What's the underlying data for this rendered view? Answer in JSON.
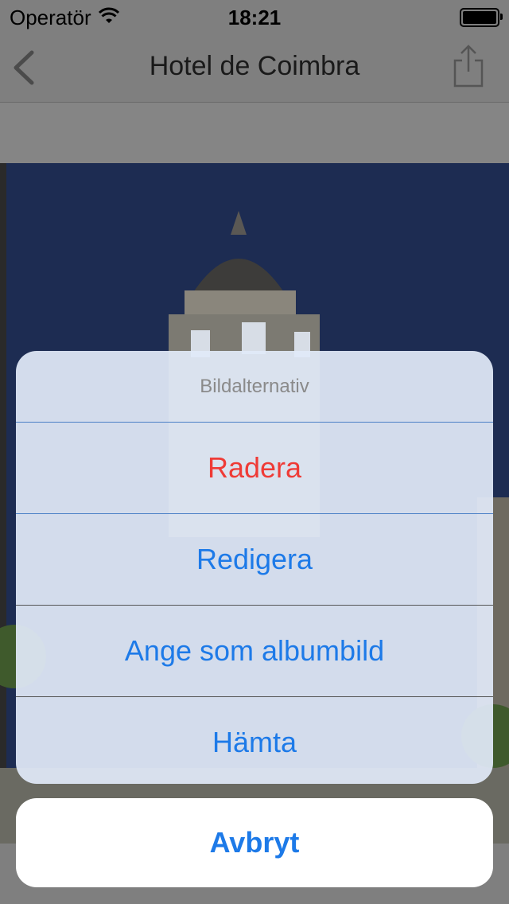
{
  "status_bar": {
    "carrier": "Operatör",
    "time": "18:21"
  },
  "nav": {
    "title": "Hotel de Coimbra",
    "back_icon": "chevron-left-icon",
    "share_icon": "share-icon"
  },
  "action_sheet": {
    "title": "Bildalternativ",
    "items": [
      {
        "label": "Radera",
        "style": "destructive"
      },
      {
        "label": "Redigera",
        "style": "default"
      },
      {
        "label": "Ange som albumbild",
        "style": "default"
      },
      {
        "label": "Hämta",
        "style": "default"
      }
    ],
    "cancel_label": "Avbryt"
  },
  "colors": {
    "accent": "#1d7ae8",
    "destructive": "#ef3b36"
  }
}
